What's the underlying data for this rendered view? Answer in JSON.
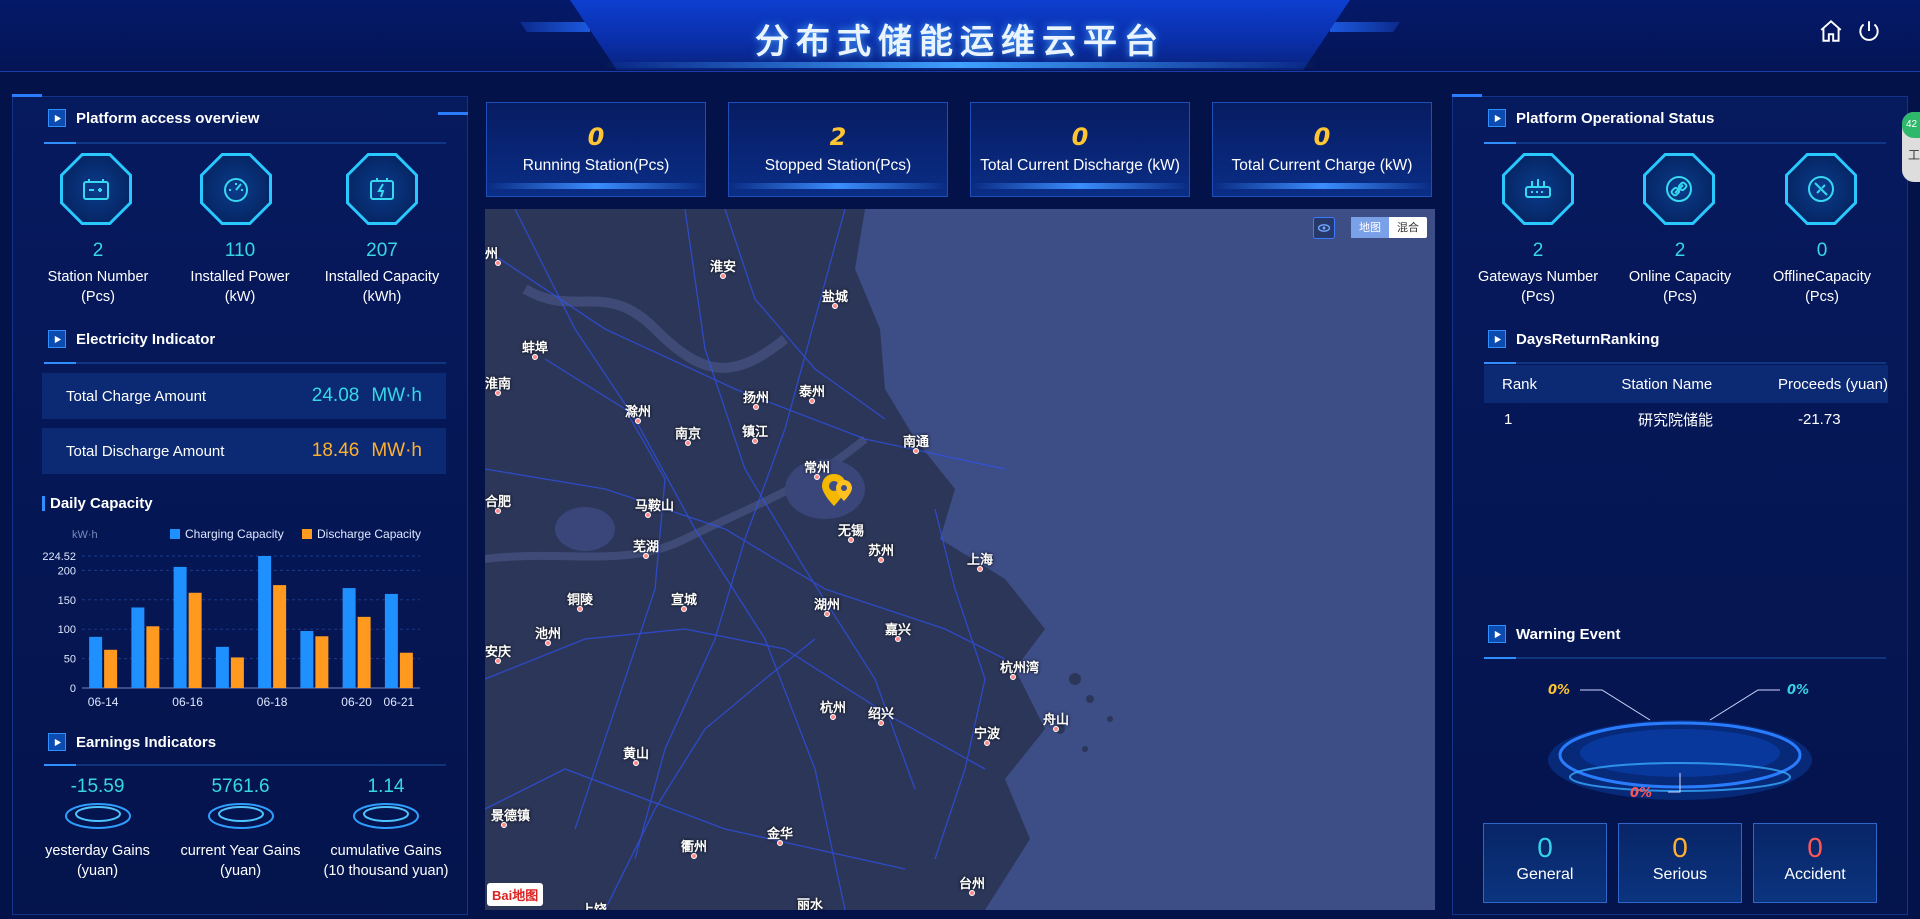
{
  "header": {
    "title": "分布式储能运维云平台"
  },
  "left": {
    "access": {
      "title": "Platform access overview",
      "stats": [
        {
          "value": "2",
          "label1": "Station Number",
          "label2": "(Pcs)"
        },
        {
          "value": "110",
          "label1": "Installed Power",
          "label2": "(kW)"
        },
        {
          "value": "207",
          "label1": "Installed Capacity",
          "label2": "(kWh)"
        }
      ]
    },
    "electricity": {
      "title": "Electricity Indicator",
      "rows": [
        {
          "label": "Total Charge Amount",
          "value": "24.08",
          "unit": "MW·h"
        },
        {
          "label": "Total Discharge Amount",
          "value": "18.46",
          "unit": "MW·h"
        }
      ]
    },
    "earnings": {
      "title": "Earnings Indicators",
      "items": [
        {
          "value": "-15.59",
          "label1": "yesterday Gains",
          "label2": "(yuan)"
        },
        {
          "value": "5761.6",
          "label1": "current Year Gains",
          "label2": "(yuan)"
        },
        {
          "value": "1.14",
          "label1": "cumulative Gains",
          "label2": "(10 thousand yuan)"
        }
      ]
    }
  },
  "chart_data": {
    "type": "bar",
    "title": "Daily Capacity",
    "ylabel": "kW·h",
    "ylim": [
      0,
      224.52
    ],
    "yticks": [
      "0",
      "50",
      "100",
      "150",
      "200",
      "224.52"
    ],
    "xtick_labels": [
      "06-14",
      "06-16",
      "06-18",
      "06-20",
      "06-21"
    ],
    "categories": [
      "06-14",
      "06-15",
      "06-16",
      "06-17",
      "06-18",
      "06-19",
      "06-20",
      "06-21"
    ],
    "series": [
      {
        "name": "Charging Capacity",
        "color": "#1e90ff",
        "values": [
          87,
          137,
          206,
          70,
          224.52,
          97,
          170,
          160
        ]
      },
      {
        "name": "Discharge Capacity",
        "color": "#ff9a1f",
        "values": [
          65,
          105,
          162,
          52,
          175,
          88,
          121,
          60
        ]
      }
    ],
    "legend": "top-right",
    "grid": true
  },
  "cards": [
    {
      "value": "0",
      "label": "Running Station(Pcs)"
    },
    {
      "value": "2",
      "label": "Stopped Station(Pcs)"
    },
    {
      "value": "0",
      "label": "Total Current Discharge (kW)"
    },
    {
      "value": "0",
      "label": "Total Current Charge (kW)"
    }
  ],
  "map": {
    "type_buttons": [
      "地图",
      "混合"
    ],
    "logo": "Bai地图",
    "cities": [
      {
        "name": "淮安"
      },
      {
        "name": "盐城"
      },
      {
        "name": "蚌埠"
      },
      {
        "name": "扬州"
      },
      {
        "name": "泰州"
      },
      {
        "name": "滁州"
      },
      {
        "name": "南京"
      },
      {
        "name": "镇江"
      },
      {
        "name": "南通"
      },
      {
        "name": "常州"
      },
      {
        "name": "合肥"
      },
      {
        "name": "马鞍山"
      },
      {
        "name": "无锡"
      },
      {
        "name": "芜湖"
      },
      {
        "name": "苏州"
      },
      {
        "name": "上海"
      },
      {
        "name": "铜陵"
      },
      {
        "name": "宣城"
      },
      {
        "name": "湖州"
      },
      {
        "name": "嘉兴"
      },
      {
        "name": "池州"
      },
      {
        "name": "安庆"
      },
      {
        "name": "杭州湾"
      },
      {
        "name": "杭州"
      },
      {
        "name": "绍兴"
      },
      {
        "name": "宁波"
      },
      {
        "name": "舟山"
      },
      {
        "name": "黄山"
      },
      {
        "name": "景德镇"
      },
      {
        "name": "金华"
      },
      {
        "name": "衢州"
      },
      {
        "name": "台州"
      },
      {
        "name": "丽水"
      },
      {
        "name": "上饶"
      },
      {
        "name": "淮南"
      },
      {
        "name": "州"
      }
    ]
  },
  "right": {
    "status": {
      "title": "Platform Operational Status",
      "stats": [
        {
          "value": "2",
          "label1": "Gateways Number",
          "label2": "(Pcs)"
        },
        {
          "value": "2",
          "label1": "Online Capacity",
          "label2": "(Pcs)"
        },
        {
          "value": "0",
          "label1": "OfflineCapacity",
          "label2": "(Pcs)"
        }
      ]
    },
    "ranking": {
      "title": "DaysReturnRanking",
      "headers": [
        "Rank",
        "Station Name",
        "Proceeds (yuan)"
      ],
      "rows": [
        {
          "rank": "1",
          "name": "研究院储能",
          "proceeds": "-21.73"
        }
      ]
    },
    "warning": {
      "title": "Warning Event",
      "pcts": [
        "0%",
        "0%",
        "0%"
      ],
      "boxes": [
        {
          "value": "0",
          "label": "General",
          "color": "#35d2e8"
        },
        {
          "value": "0",
          "label": "Serious",
          "color": "#ffb02e"
        },
        {
          "value": "0",
          "label": "Accident",
          "color": "#ff5656"
        }
      ]
    }
  },
  "edge_badge": {
    "value": "42",
    "text": "工"
  }
}
